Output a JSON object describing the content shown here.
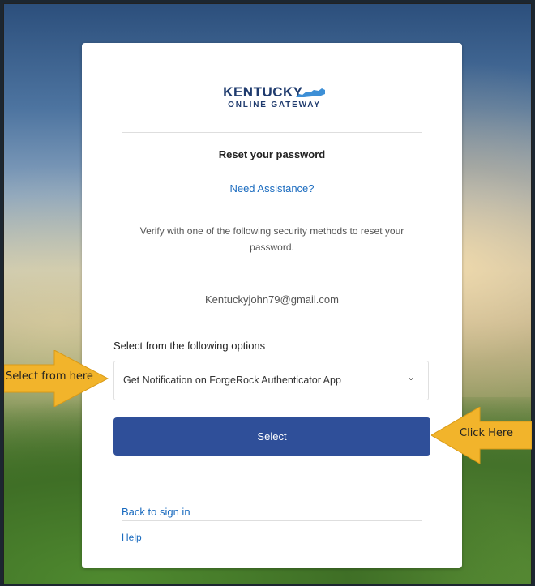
{
  "logo": {
    "line1": "KENTUCKY",
    "line2": "ONLINE GATEWAY",
    "icon": "kentucky-state-shape-icon"
  },
  "form": {
    "title": "Reset your password",
    "assist_link": "Need Assistance?",
    "description": "Verify with one of the following security methods to reset your password.",
    "email": "Kentuckyjohn79@gmail.com",
    "options_label": "Select from the following options",
    "select_value": "Get Notification on ForgeRock Authenticator App",
    "select_icon": "chevron-down-icon",
    "button_label": "Select",
    "back_link": "Back to sign in",
    "help_link": "Help"
  },
  "annotations": {
    "left_arrow": "Select from here",
    "right_arrow": "Click Here",
    "arrow_color": "#f2b42b"
  },
  "colors": {
    "brand": "#1f3b6e",
    "button": "#2f4f99",
    "link": "#1a6bbf"
  }
}
